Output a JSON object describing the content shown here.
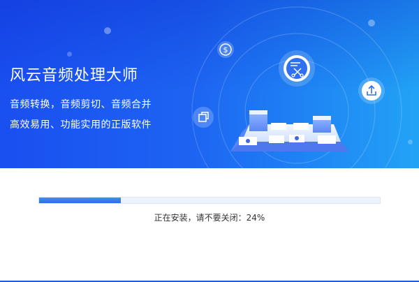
{
  "app": {
    "title": "风云音频处理大师",
    "tagline_1": "音频转换，音频剪切、音频合并",
    "tagline_2": "高效易用、功能实用的正版软件"
  },
  "banner": {
    "icons": [
      "dollar-icon",
      "scissors-icon",
      "upload-icon",
      "copy-icon"
    ],
    "colors": {
      "gradient_start": "#1a4ff0",
      "gradient_end": "#22a3f6",
      "accent": "#2a6fe6"
    }
  },
  "install": {
    "progress": 0.24,
    "status_text": "正在安装，请不要关闭：24%"
  }
}
